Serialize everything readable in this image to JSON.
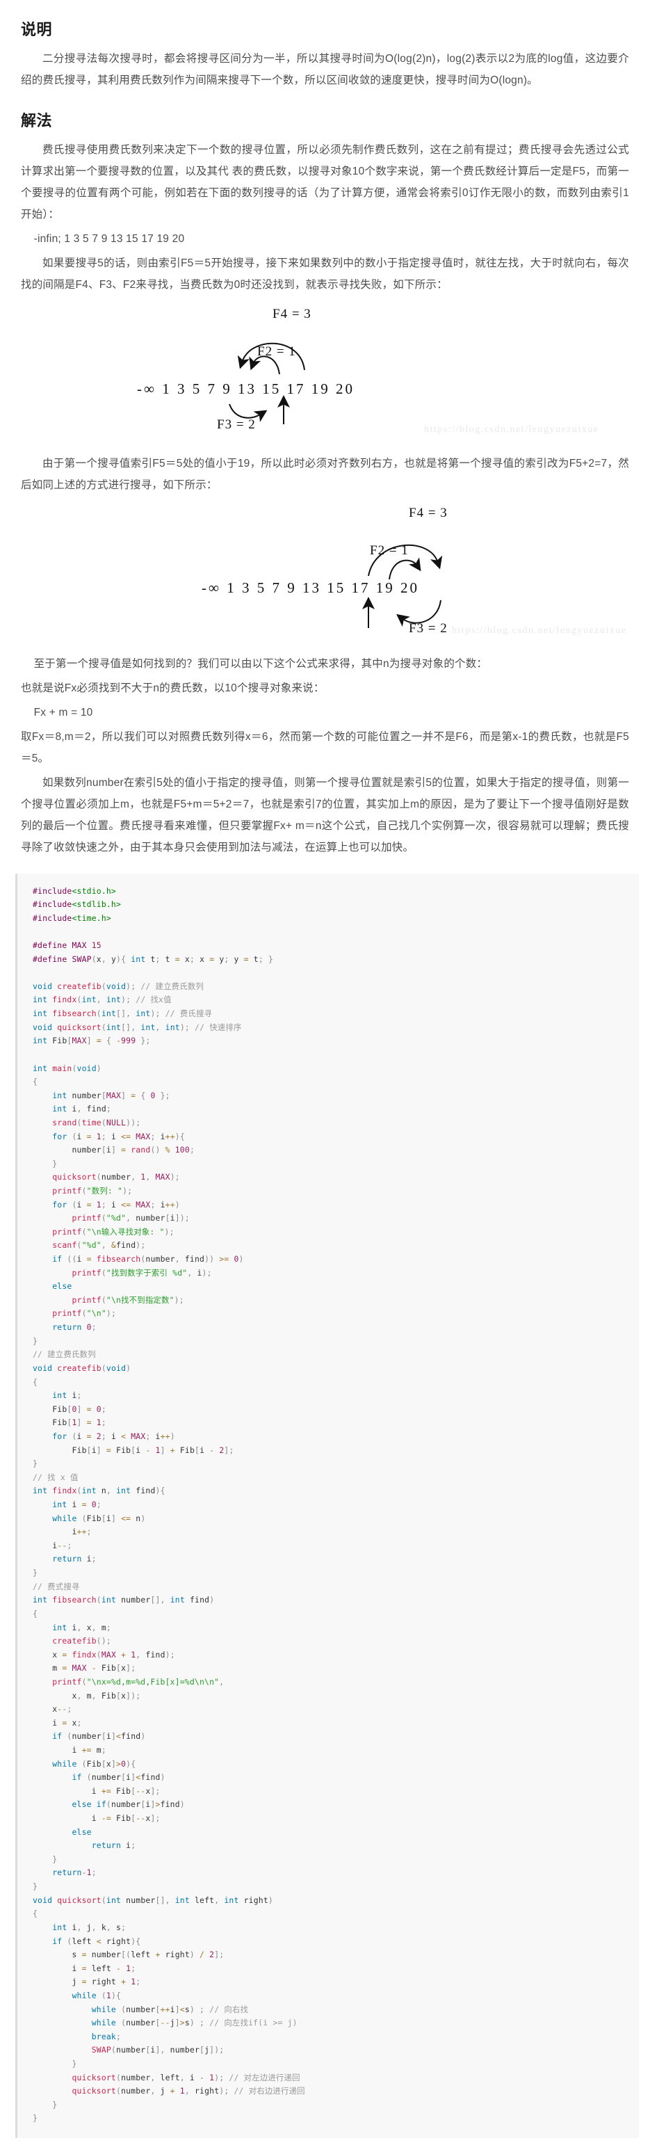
{
  "watermark": "https://blog.csdn.net/lengyuezuixue",
  "sections": {
    "explain": {
      "title": "说明",
      "paragraphs": [
        "二分搜寻法每次搜寻时，都会将搜寻区间分为一半，所以其搜寻时间为O(log(2)n)，log(2)表示以2为底的log值，这边要介绍的费氏搜寻，其利用费氏数列作为间隔来搜寻下一个数，所以区间收敛的速度更快，搜寻时间为O(logn)。"
      ]
    },
    "solution": {
      "title": "解法",
      "p1": "费氏搜寻使用费氏数列来决定下一个数的搜寻位置，所以必须先制作费氏数列，这在之前有提过；费氏搜寻会先透过公式计算求出第一个要搜寻数的位置，以及其代 表的费氏数，以搜寻对象10个数字来说，第一个费氏数经计算后一定是F5，而第一个要搜寻的位置有两个可能，例如若在下面的数列搜寻的话（为了计算方便，通常会将索引0订作无限小的数，而数列由索引1开始）：",
      "seq_line": "-infin; 1 3 5 7 9 13 15 17 19 20",
      "p2": "如果要搜寻5的话，则由索引F5＝5开始搜寻，接下来如果数列中的数小于指定搜寻值时，就往左找，大于时就向右，每次找的间隔是F4、F3、F2来寻找，当费氏数为0时还没找到，就表示寻找失败，如下所示：",
      "p3": "由于第一个搜寻值索引F5＝5处的值小于19，所以此时必须对齐数列右方，也就是将第一个搜寻值的索引改为F5+2=7，然后如同上述的方式进行搜寻，如下所示：",
      "p4": "至于第一个搜寻值是如何找到的？我们可以由以下这个公式来求得，其中n为搜寻对象的个数：",
      "p5": "也就是说Fx必须找到不大于n的费氏数，以10个搜寻对象来说：",
      "formula": "Fx + m = 10",
      "p6": "取Fx＝8,m＝2，所以我们可以对照费氏数列得x＝6，然而第一个数的可能位置之一并不是F6，而是第x-1的费氏数，也就是F5＝5。",
      "p7": "如果数列number在索引5处的值小于指定的搜寻值，则第一个搜寻位置就是索引5的位置，如果大于指定的搜寻值，则第一个搜寻位置必须加上m，也就是F5+m＝5+2＝7，也就是索引7的位置，其实加上m的原因，是为了要让下一个搜寻值刚好是数列的最后一个位置。费氏搜寻看来难懂，但只要掌握Fx+ m＝n这个公式，自己找几个实例算一次，很容易就可以理解；费氏搜寻除了收敛快速之外，由于其本身只会使用到加法与减法，在运算上也可以加快。"
    }
  },
  "figure1": {
    "label_f4": "F4 = 3",
    "label_f2": "F2 = 1",
    "label_f3": "F3 = 2",
    "sequence": "-∞  1  3  5  7  9  13  15  17  19  20"
  },
  "figure2": {
    "label_f4": "F4 = 3",
    "label_f2": "F2 = 1",
    "label_f3": "F3 = 2",
    "sequence": "-∞  1  3  5  7  9  13  15  17  19  20"
  },
  "code": {
    "language": "c",
    "lines": [
      "#include<stdio.h>",
      "#include<stdlib.h>",
      "#include<time.h>",
      "",
      "#define MAX 15",
      "#define SWAP(x, y){ int t; t = x; x = y; y = t; }",
      "",
      "void createfib(void); // 建立费氏数列",
      "int findx(int, int); // 找x值",
      "int fibsearch(int[], int); // 费氏搜寻",
      "void quicksort(int[], int, int); // 快速排序",
      "int Fib[MAX] = { -999 };",
      "",
      "int main(void)",
      "{",
      "    int number[MAX] = { 0 };",
      "    int i, find;",
      "    srand(time(NULL));",
      "    for (i = 1; i <= MAX; i++){",
      "        number[i] = rand() % 100;",
      "    }",
      "    quicksort(number, 1, MAX);",
      "    printf(\"数列: \");",
      "    for (i = 1; i <= MAX; i++)",
      "        printf(\"%d\", number[i]);",
      "    printf(\"\\n输入寻找对象: \");",
      "    scanf(\"%d\", &find);",
      "    if ((i = fibsearch(number, find)) >= 0)",
      "        printf(\"找到数字于索引 %d\", i);",
      "    else",
      "        printf(\"\\n找不到指定数\");",
      "    printf(\"\\n\");",
      "    return 0;",
      "}",
      "// 建立费氏数列",
      "void createfib(void)",
      "{",
      "    int i;",
      "    Fib[0] = 0;",
      "    Fib[1] = 1;",
      "    for (i = 2; i < MAX; i++)",
      "        Fib[i] = Fib[i - 1] + Fib[i - 2];",
      "}",
      "// 找 x 值",
      "int findx(int n, int find){",
      "    int i = 0;",
      "    while (Fib[i] <= n)",
      "        i++;",
      "    i--;",
      "    return i;",
      "}",
      "// 费式搜寻",
      "int fibsearch(int number[], int find)",
      "{",
      "    int i, x, m;",
      "    createfib();",
      "    x = findx(MAX + 1, find);",
      "    m = MAX - Fib[x];",
      "    printf(\"\\nx=%d,m=%d,Fib[x]=%d\\n\\n\",",
      "        x, m, Fib[x]);",
      "    x--;",
      "    i = x;",
      "    if (number[i]<find)",
      "        i += m;",
      "    while (Fib[x]>0){",
      "        if (number[i]<find)",
      "            i += Fib[--x];",
      "        else if(number[i]>find)",
      "            i -= Fib[--x];",
      "        else",
      "            return i;",
      "    }",
      "    return-1;",
      "}",
      "void quicksort(int number[], int left, int right)",
      "{",
      "    int i, j, k, s;",
      "    if (left < right){",
      "        s = number[(left + right) / 2];",
      "        i = left - 1;",
      "        j = right + 1;",
      "        while (1){",
      "            while (number[++i]<s) ; // 向右找",
      "            while (number[--j]>s) ; // 向左找if(i >= j)",
      "            break;",
      "            SWAP(number[i], number[j]);",
      "        }",
      "        quicksort(number, left, i - 1); // 对左边进行递回",
      "        quicksort(number, j + 1, right); // 对右边进行递回",
      "    }",
      "}"
    ]
  }
}
